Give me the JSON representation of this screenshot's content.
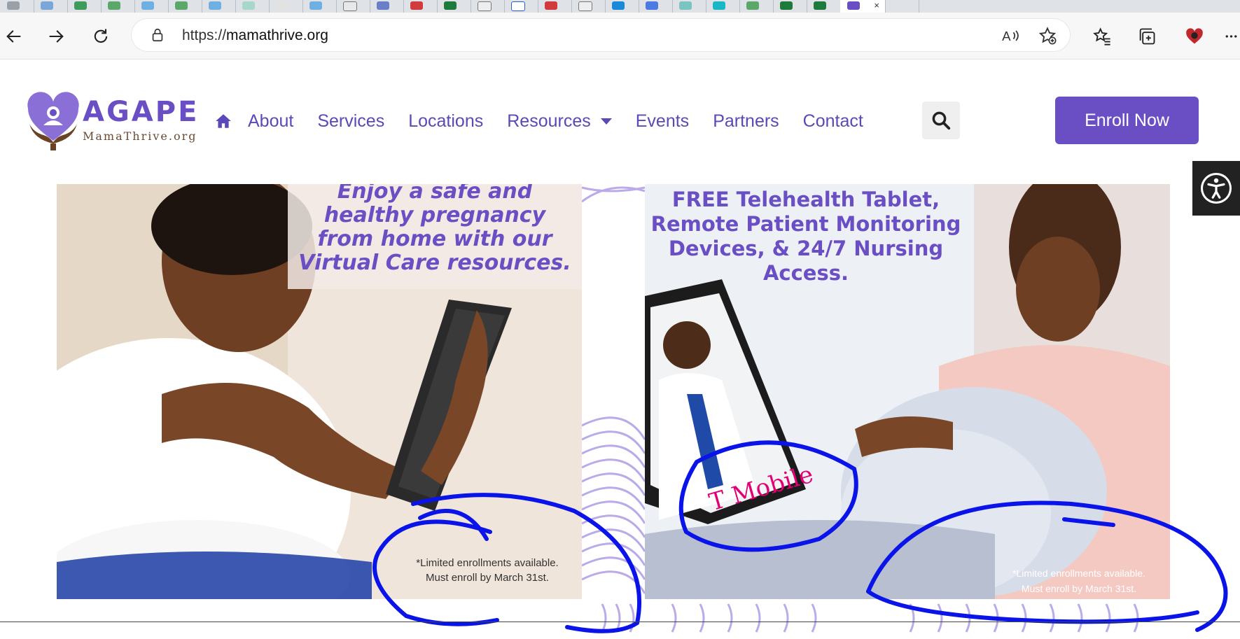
{
  "browser": {
    "tab_close": "×",
    "url_scheme": "https://",
    "url_host": "mamathrive.org"
  },
  "site": {
    "brand": "AGAPE",
    "tagline": "MamaThrive.org",
    "nav": [
      "About",
      "Services",
      "Locations",
      "Resources",
      "Events",
      "Partners",
      "Contact"
    ],
    "cta": "Enroll Now"
  },
  "cards": {
    "left_headline": "Enjoy a safe and healthy pregnancy from home with our Virtual Care resources.",
    "left_fine_line1": "*Limited enrollments available.",
    "left_fine_line2": "Must enroll  by March 31st.",
    "right_headline": "FREE Telehealth Tablet, Remote Patient Monitoring Devices, & 24/7 Nursing Access.",
    "right_logo_text": "T Mobile",
    "right_fine_line1": "*Limited enrollments available.",
    "right_fine_line2": "Must enroll  by March 31st."
  },
  "colors": {
    "brand_purple": "#6a4fc4",
    "annotation_blue": "#0a14e8",
    "tmobile_magenta": "#e20074"
  }
}
